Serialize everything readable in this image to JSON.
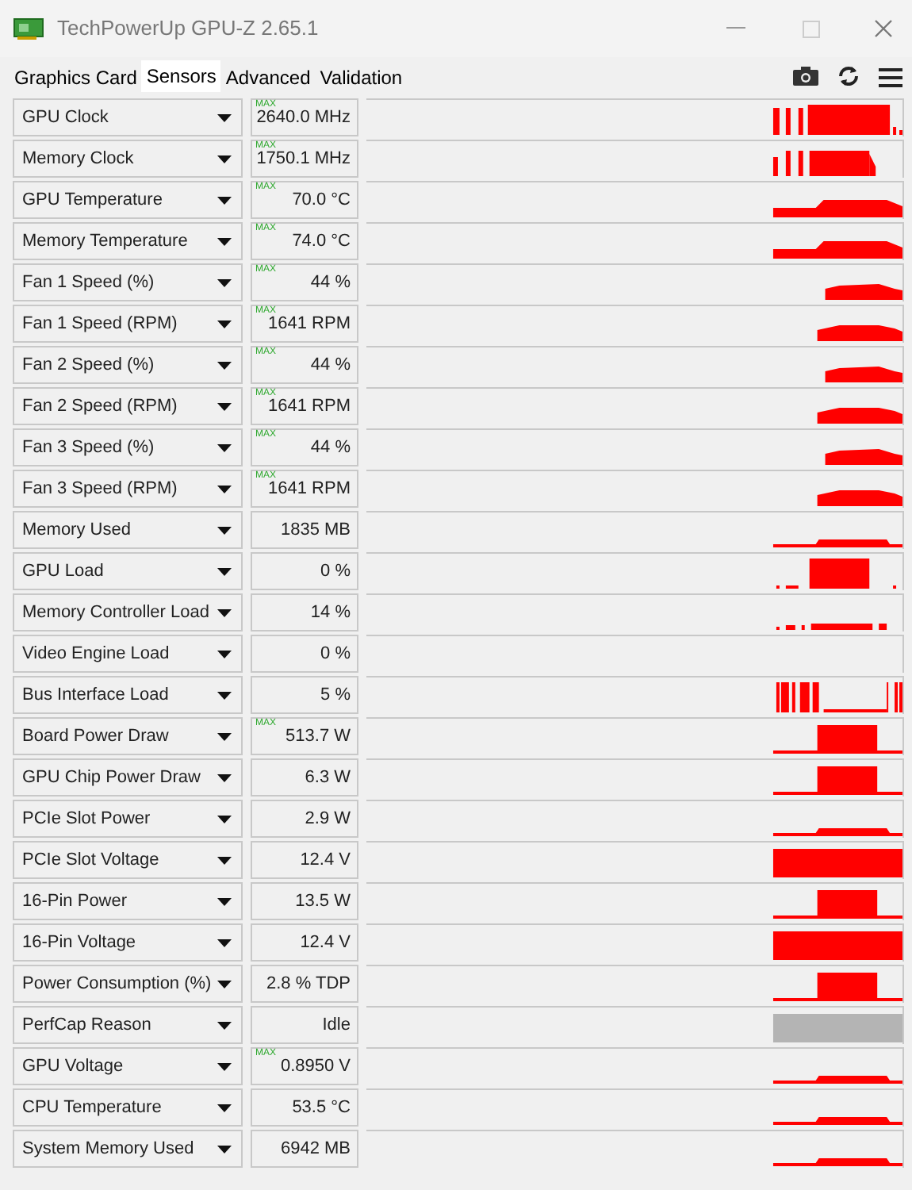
{
  "window": {
    "title": "TechPowerUp GPU-Z 2.65.1"
  },
  "tabs": [
    {
      "label": "Graphics Card",
      "selected": false
    },
    {
      "label": "Sensors",
      "selected": true
    },
    {
      "label": "Advanced",
      "selected": false
    },
    {
      "label": "Validation",
      "selected": false
    }
  ],
  "sensors": [
    {
      "name": "GPU Clock",
      "max_label": "MAX",
      "value": "2640.0 MHz",
      "color": "#ff0000"
    },
    {
      "name": "Memory Clock",
      "max_label": "MAX",
      "value": "1750.1 MHz",
      "color": "#ff0000"
    },
    {
      "name": "GPU Temperature",
      "max_label": "MAX",
      "value": "70.0 °C",
      "color": "#ff0000"
    },
    {
      "name": "Memory Temperature",
      "max_label": "MAX",
      "value": "74.0 °C",
      "color": "#ff0000"
    },
    {
      "name": "Fan 1 Speed (%)",
      "max_label": "MAX",
      "value": "44 %",
      "color": "#ff0000"
    },
    {
      "name": "Fan 1 Speed (RPM)",
      "max_label": "MAX",
      "value": "1641 RPM",
      "color": "#ff0000"
    },
    {
      "name": "Fan 2 Speed (%)",
      "max_label": "MAX",
      "value": "44 %",
      "color": "#ff0000"
    },
    {
      "name": "Fan 2 Speed (RPM)",
      "max_label": "MAX",
      "value": "1641 RPM",
      "color": "#ff0000"
    },
    {
      "name": "Fan 3 Speed (%)",
      "max_label": "MAX",
      "value": "44 %",
      "color": "#ff0000"
    },
    {
      "name": "Fan 3 Speed (RPM)",
      "max_label": "MAX",
      "value": "1641 RPM",
      "color": "#ff0000"
    },
    {
      "name": "Memory Used",
      "value": "1835 MB",
      "color": "#ff0000"
    },
    {
      "name": "GPU Load",
      "value": "0 %",
      "color": "#ff0000"
    },
    {
      "name": "Memory Controller Load",
      "value": "14 %",
      "color": "#ff0000"
    },
    {
      "name": "Video Engine Load",
      "value": "0 %"
    },
    {
      "name": "Bus Interface Load",
      "value": "5 %",
      "color": "#ff0000"
    },
    {
      "name": "Board Power Draw",
      "max_label": "MAX",
      "value": "513.7 W",
      "color": "#ff0000"
    },
    {
      "name": "GPU Chip Power Draw",
      "value": "6.3 W",
      "color": "#ff0000"
    },
    {
      "name": "PCIe Slot Power",
      "value": "2.9 W",
      "color": "#ff0000"
    },
    {
      "name": "PCIe Slot Voltage",
      "value": "12.4 V",
      "color": "#ff0000"
    },
    {
      "name": "16-Pin Power",
      "value": "13.5 W",
      "color": "#ff0000"
    },
    {
      "name": "16-Pin Voltage",
      "value": "12.4 V",
      "color": "#ff0000"
    },
    {
      "name": "Power Consumption (%)",
      "value": "2.8 % TDP",
      "color": "#ff0000"
    },
    {
      "name": "PerfCap Reason",
      "value": "Idle",
      "color": "#b4b4b4"
    },
    {
      "name": "GPU Voltage",
      "max_label": "MAX",
      "value": "0.8950 V",
      "color": "#ff0000"
    },
    {
      "name": "CPU Temperature",
      "value": "53.5 °C",
      "color": "#ff0000"
    },
    {
      "name": "System Memory Used",
      "value": "6942 MB",
      "color": "#ff0000"
    }
  ]
}
